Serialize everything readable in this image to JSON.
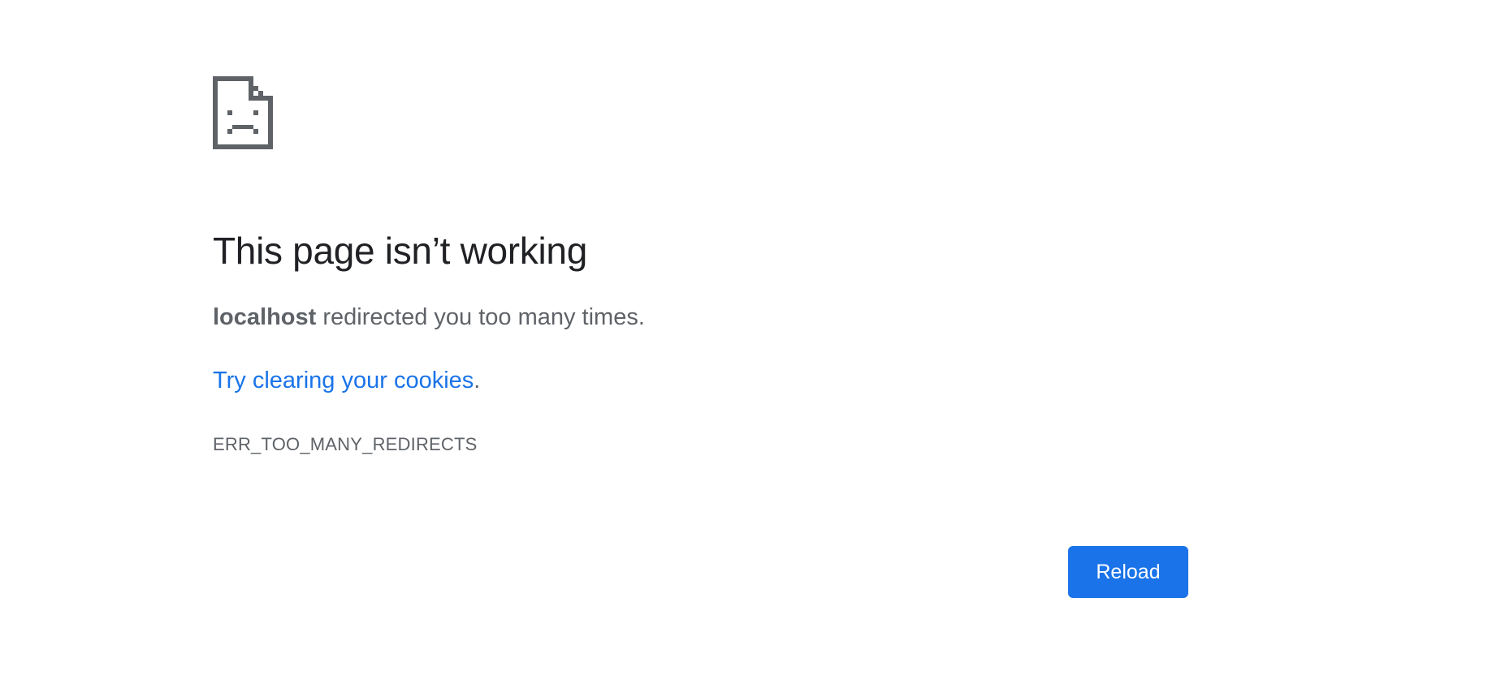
{
  "error": {
    "icon": "sad-page-icon",
    "title": "This page isn’t working",
    "host": "localhost",
    "message_rest": " redirected you too many times.",
    "suggestion_link": "Try clearing your cookies",
    "suggestion_tail": ".",
    "code": "ERR_TOO_MANY_REDIRECTS"
  },
  "actions": {
    "reload_label": "Reload"
  },
  "colors": {
    "accent": "#1a73e8",
    "title": "#202124",
    "body_text": "#5f6368",
    "icon": "#5f6368"
  }
}
